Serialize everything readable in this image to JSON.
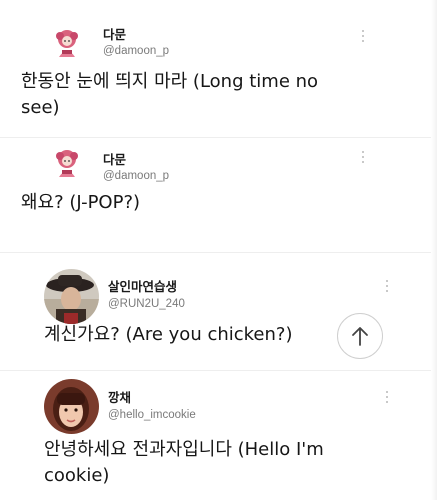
{
  "tweets": [
    {
      "name": "다문",
      "handle": "@damoon_p",
      "text_line1": "한동안 눈에 띄지 마라 (Long time no",
      "text_line2": "see)",
      "avatar_icon": "pink-doll-avatar"
    },
    {
      "name": "다문",
      "handle": "@damoon_p",
      "text_line1": "왜요? (J-POP?)",
      "avatar_icon": "pink-doll-avatar"
    },
    {
      "name": "살인마연습생",
      "handle": "@RUN2U_240",
      "text_line1": "계신가요? (Are you chicken?)",
      "avatar_icon": "hat-portrait-avatar"
    },
    {
      "name": "깡채",
      "handle": "@hello_imcookie",
      "text_line1": "안녕하세요 전과자입니다 (Hello I'm",
      "text_line2": "cookie)",
      "avatar_icon": "girl-bangs-avatar"
    }
  ],
  "icons": {
    "more": "more-vertical-icon",
    "scroll_up": "arrow-up-icon"
  },
  "colors": {
    "handle": "#7a7a7a",
    "text": "#161616",
    "divider": "#eeeeee"
  }
}
